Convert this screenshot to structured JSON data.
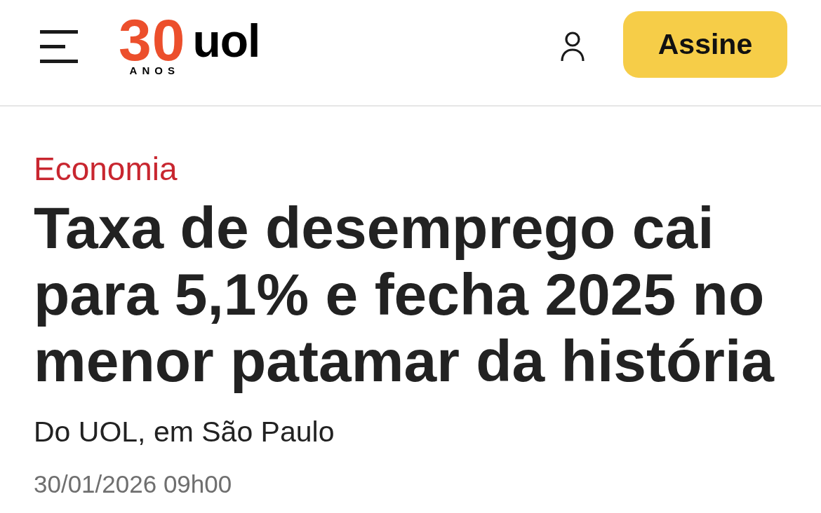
{
  "header": {
    "logo": {
      "number": "30",
      "label": "ANOS",
      "brand": "uol"
    },
    "subscribe_button": "Assine"
  },
  "article": {
    "section": "Economia",
    "headline": "Taxa de desemprego cai para 5,1% e fecha 2025 no menor patamar da história",
    "byline": "Do UOL, em São Paulo",
    "timestamp": "30/01/2026 09h00"
  }
}
